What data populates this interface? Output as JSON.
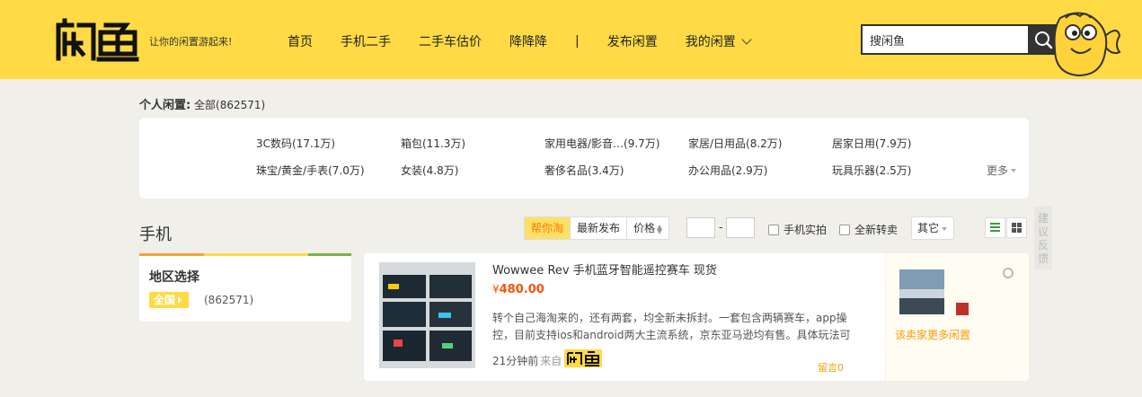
{
  "header": {
    "logo_text": "闲鱼",
    "slogan": "让你的闲置游起来!",
    "nav": [
      "首页",
      "手机二手",
      "二手车估价",
      "降降降"
    ],
    "nav_separator": "|",
    "nav_publish": "发布闲置",
    "nav_mine": "我的闲置",
    "search_value": "搜闲鱼"
  },
  "breadcrumb": {
    "label": "个人闲置",
    "colon": ":",
    "all": "全部(862571)"
  },
  "categories": {
    "row1": [
      "3C数码(17.1万)",
      "箱包(11.3万)",
      "家用电器/影音…(9.7万)",
      "家居/日用品(8.2万)",
      "居家日用(7.9万)"
    ],
    "row2": [
      "珠宝/黄金/手表(7.0万)",
      "女装(4.8万)",
      "奢侈名品(3.4万)",
      "办公用品(2.9万)",
      "玩具乐器(2.5万)"
    ],
    "more": "更多"
  },
  "section": {
    "title": "手机"
  },
  "filters": {
    "sort": [
      "帮你淘",
      "最新发布",
      "价格"
    ],
    "price_dash": "-",
    "checks": [
      "手机实拍",
      "全新转卖"
    ],
    "other": "其它"
  },
  "feedback": "建议反馈",
  "region": {
    "title": "地区选择",
    "tag": "全国",
    "count": "(862571)"
  },
  "item": {
    "title": "Wowwee Rev 手机蓝牙智能遥控赛车 现货",
    "currency": "¥",
    "price": "480.00",
    "description": "转个自己海淘来的，还有两套，均全新未拆封。一套包含两辆赛车，app操控，目前支持ios和android两大主流系统，京东亚马逊均有售。具体玩法可看",
    "time": "21分钟前",
    "from": "来自",
    "comments": "留言0",
    "seller_more": "该卖家更多闲置"
  },
  "colors": {
    "brand": "#ffda44",
    "price": "#ff5000",
    "accent": "#ff9900"
  }
}
